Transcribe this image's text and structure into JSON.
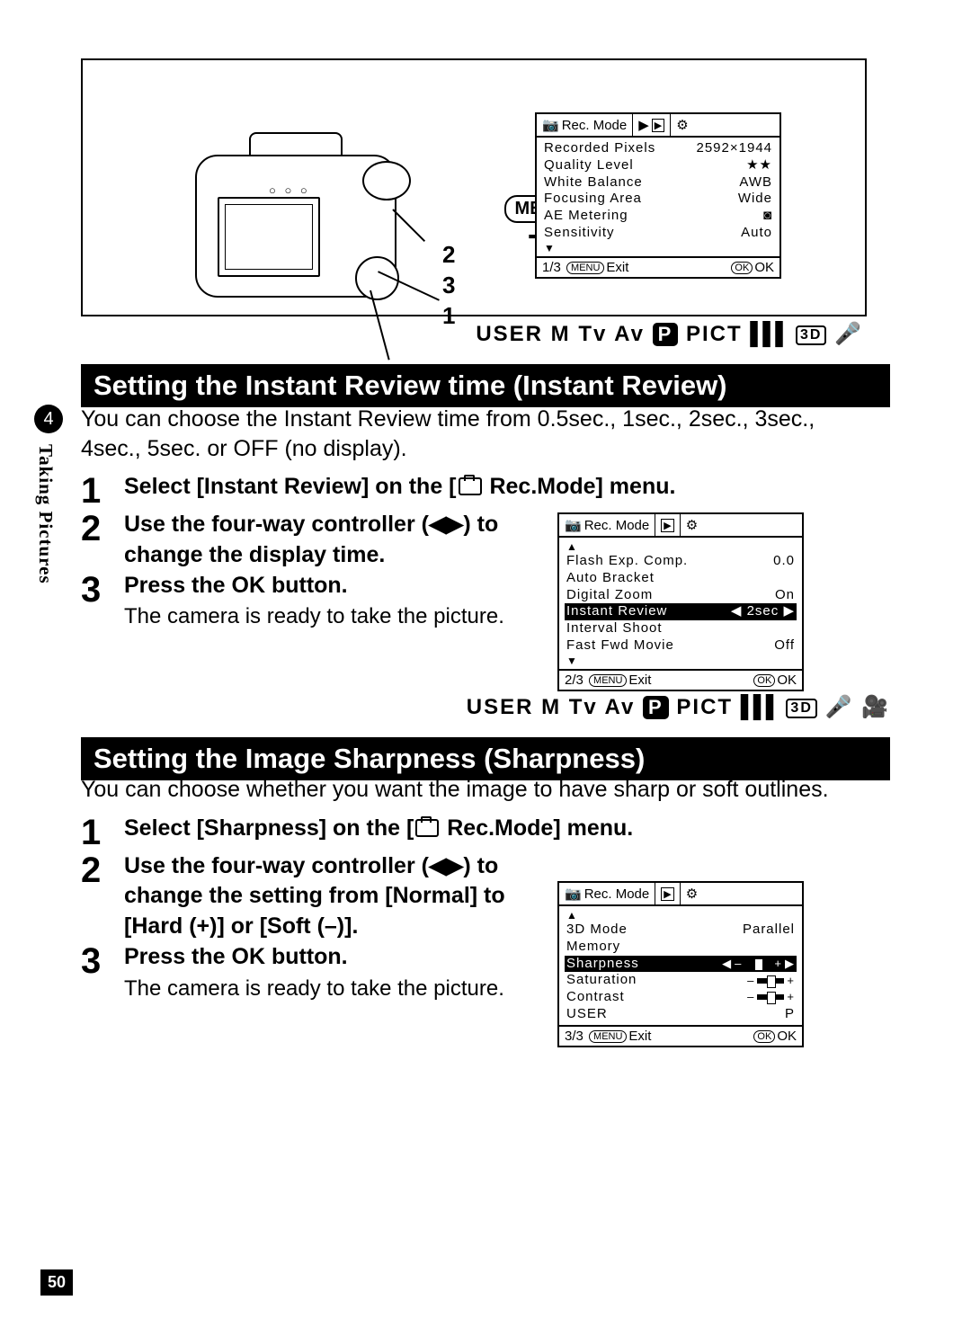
{
  "page_number": "50",
  "side": {
    "chapter_num": "4",
    "chapter_label": "Taking Pictures"
  },
  "top_diagram": {
    "menu_label": "MENU",
    "callouts": [
      "2",
      "3",
      "1"
    ]
  },
  "menu_screen_1": {
    "tab_active": "Rec. Mode",
    "rows": [
      {
        "label": "Recorded Pixels",
        "value": "2592×1944"
      },
      {
        "label": "Quality Level",
        "value": "★★"
      },
      {
        "label": "White Balance",
        "value": "AWB"
      },
      {
        "label": "Focusing Area",
        "value": "Wide"
      },
      {
        "label": "AE Metering",
        "value": "◙"
      },
      {
        "label": "Sensitivity",
        "value": "Auto"
      }
    ],
    "footer_left": "1/3",
    "footer_menu": "MENU",
    "footer_exit": "Exit",
    "footer_ok": "OK",
    "footer_ok_label": "OK"
  },
  "mode_strip_1": "USER M Tv Av",
  "mode_strip_pict": "PICT",
  "section_1_title": "Setting the Instant Review time (Instant Review)",
  "section_1_intro": "You can choose the Instant Review time from 0.5sec., 1sec., 2sec., 3sec., 4sec., 5sec. or OFF (no display).",
  "section_1_steps": [
    {
      "n": "1",
      "text": "Select [Instant Review] on the [",
      "text_end": " Rec.Mode] menu."
    },
    {
      "n": "2",
      "text": "Use the four-way controller (◀▶) to change the display time."
    },
    {
      "n": "3",
      "text": "Press the OK button.",
      "sub": "The camera is ready to take the picture."
    }
  ],
  "menu_screen_2": {
    "tab_active": "Rec. Mode",
    "rows": [
      {
        "label": "Flash Exp. Comp.",
        "value": "0.0"
      },
      {
        "label": "Auto Bracket",
        "value": ""
      },
      {
        "label": "Digital Zoom",
        "value": "On"
      },
      {
        "label": "Instant Review",
        "value": "2sec",
        "highlight": true,
        "arrows": true
      },
      {
        "label": "Interval Shoot",
        "value": ""
      },
      {
        "label": "Fast Fwd Movie",
        "value": "Off"
      }
    ],
    "footer_left": "2/3",
    "footer_menu": "MENU",
    "footer_exit": "Exit",
    "footer_ok": "OK",
    "footer_ok_label": "OK"
  },
  "mode_strip_2": "USER M Tv Av",
  "section_2_title": "Setting the Image Sharpness (Sharpness)",
  "section_2_intro": "You can choose whether you want the image to have sharp or soft outlines.",
  "section_2_steps": [
    {
      "n": "1",
      "text": "Select [Sharpness] on the [",
      "text_end": " Rec.Mode] menu."
    },
    {
      "n": "2",
      "text": "Use the four-way controller (◀▶) to change the setting from [Normal] to [Hard (+)] or [Soft (–)]."
    },
    {
      "n": "3",
      "text": "Press the OK button.",
      "sub": "The camera is ready to take the picture."
    }
  ],
  "menu_screen_3": {
    "tab_active": "Rec. Mode",
    "rows": [
      {
        "label": "3D Mode",
        "value": "Parallel"
      },
      {
        "label": "Memory",
        "value": ""
      },
      {
        "label": "Sharpness",
        "value": "slider",
        "highlight": true,
        "arrows": true
      },
      {
        "label": "Saturation",
        "value": "slider"
      },
      {
        "label": "Contrast",
        "value": "slider"
      },
      {
        "label": "USER",
        "value": "P"
      }
    ],
    "footer_left": "3/3",
    "footer_menu": "MENU",
    "footer_exit": "Exit",
    "footer_ok": "OK",
    "footer_ok_label": "OK"
  }
}
